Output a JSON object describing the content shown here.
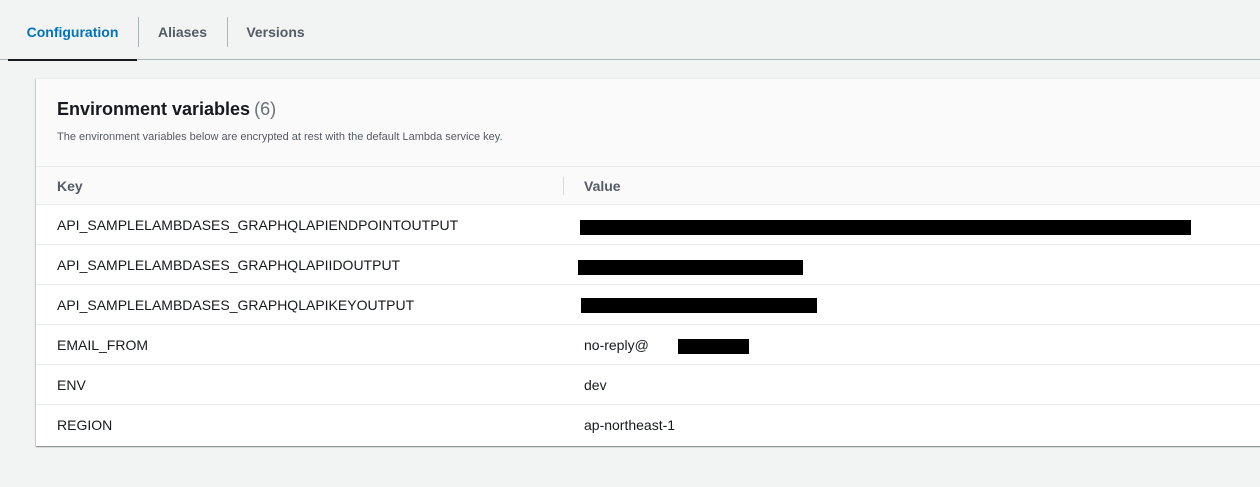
{
  "tabs": [
    {
      "label": "Configuration",
      "active": true
    },
    {
      "label": "Aliases",
      "active": false
    },
    {
      "label": "Versions",
      "active": false
    }
  ],
  "panel": {
    "title": "Environment variables",
    "count": "(6)",
    "description": "The environment variables below are encrypted at rest with the default Lambda service key."
  },
  "table": {
    "columns": [
      "Key",
      "Value"
    ],
    "rows": [
      {
        "key": "API_SAMPLELAMBDASES_GRAPHQLAPIENDPOINTOUTPUT",
        "value": "",
        "redacted": true
      },
      {
        "key": "API_SAMPLELAMBDASES_GRAPHQLAPIIDOUTPUT",
        "value": "",
        "redacted": true
      },
      {
        "key": "API_SAMPLELAMBDASES_GRAPHQLAPIKEYOUTPUT",
        "value": "",
        "redacted": true
      },
      {
        "key": "EMAIL_FROM",
        "value": "no-reply@",
        "redacted": true
      },
      {
        "key": "ENV",
        "value": "dev",
        "redacted": false
      },
      {
        "key": "REGION",
        "value": "ap-northeast-1",
        "redacted": false
      }
    ]
  },
  "colors": {
    "accent": "#0073bb",
    "redaction": "#000000"
  }
}
